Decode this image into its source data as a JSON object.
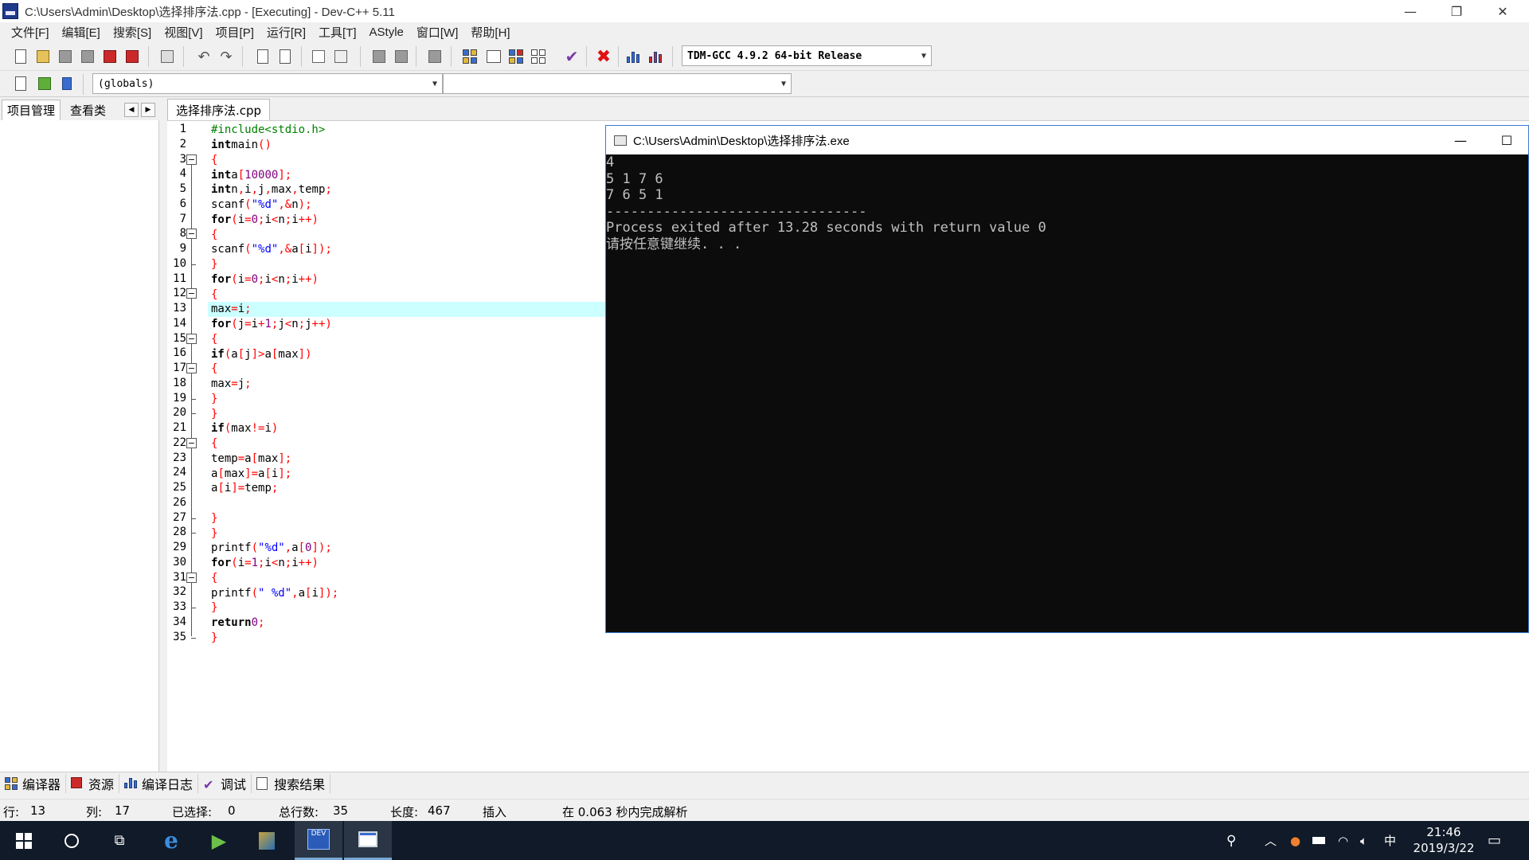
{
  "window": {
    "title": "C:\\Users\\Admin\\Desktop\\选择排序法.cpp - [Executing] - Dev-C++ 5.11",
    "minimize": "—",
    "restore": "❐",
    "close": "✕"
  },
  "menu": [
    "文件[F]",
    "编辑[E]",
    "搜索[S]",
    "视图[V]",
    "项目[P]",
    "运行[R]",
    "工具[T]",
    "AStyle",
    "窗口[W]",
    "帮助[H]"
  ],
  "toolbar": {
    "compiler_select": "TDM-GCC 4.9.2 64-bit Release",
    "scope_select": "(globals)",
    "member_select": ""
  },
  "left_panel": {
    "tab_project": "项目管理",
    "tab_classes": "查看类",
    "nav_prev": "◀",
    "nav_next": "▶"
  },
  "editor": {
    "tab": "选择排序法.cpp",
    "highlighted_line": 13,
    "lines": [
      "#include<stdio.h>",
      "int main()",
      "{",
      "    int a[10000];",
      "    int n,i,j,max,temp;",
      "    scanf(\"%d\",&n);",
      "    for (i = 0; i < n; i++)",
      "    {",
      "    scanf(\"%d\",&a[i]);",
      "    }",
      "    for (i = 0; i < n ; i++)",
      "    {",
      "        max = i;",
      "        for (j = i + 1; j < n; j++)",
      "        {",
      "            if (a[j] > a[max])",
      "            {",
      "                max = j;",
      "            }",
      "        }",
      "        if (max != i)",
      "        {",
      "            temp = a[max];",
      "            a[max] = a[i];",
      "            a[i] = temp;",
      "",
      "        }",
      "    }",
      "    printf(\"%d\",a[0]);",
      "    for (i = 1; i < n; i++)",
      "    {",
      "        printf(\" %d\",a[i]);",
      "    }",
      "    return 0;",
      "}"
    ]
  },
  "console": {
    "title": "C:\\Users\\Admin\\Desktop\\选择排序法.exe",
    "minimize": "—",
    "maximize": "☐",
    "lines": [
      "4",
      "5 1 7 6",
      "7 6 5 1",
      "--------------------------------",
      "Process exited after 13.28 seconds with return value 0",
      "请按任意键继续. . ."
    ]
  },
  "bottom_tabs": [
    {
      "label": "编译器",
      "icon": "grid-icon"
    },
    {
      "label": "资源",
      "icon": "resources-icon"
    },
    {
      "label": "编译日志",
      "icon": "chart-icon"
    },
    {
      "label": "调试",
      "icon": "check-icon"
    },
    {
      "label": "搜索结果",
      "icon": "search-icon"
    }
  ],
  "status": {
    "row_label": "行:",
    "row_value": "13",
    "col_label": "列:",
    "col_value": "17",
    "sel_label": "已选择:",
    "sel_value": "0",
    "lines_label": "总行数:",
    "lines_value": "35",
    "len_label": "长度:",
    "len_value": "467",
    "mode": "插入",
    "parse_msg": "在 0.063 秒内完成解析"
  },
  "taskbar": {
    "time": "21:46",
    "date": "2019/3/22",
    "ime": "中"
  },
  "colors": {
    "keyword": "#000000",
    "string": "#0000ff",
    "symbol": "#ff0000",
    "number": "#800080",
    "preprocessor": "#008000",
    "current_line": "#ccffff",
    "console_bg": "#0c0c0c"
  }
}
